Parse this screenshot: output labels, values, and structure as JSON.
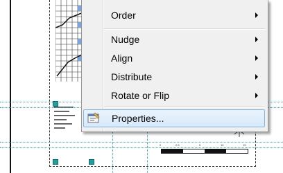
{
  "context_menu": {
    "items": [
      {
        "label": "Order",
        "has_submenu": true
      },
      {
        "label": "Nudge",
        "has_submenu": true
      },
      {
        "label": "Align",
        "has_submenu": true
      },
      {
        "label": "Distribute",
        "has_submenu": true
      },
      {
        "label": "Rotate or Flip",
        "has_submenu": true
      },
      {
        "label": "Properties...",
        "has_submenu": false,
        "highlighted": true,
        "icon": "properties-icon"
      }
    ]
  },
  "layout_view": {
    "scalebar_ticks": [
      "0",
      "2.5",
      "5",
      "10",
      "15"
    ],
    "guide_color": "#2aa7d6",
    "highlight_color": "#d8e9fa",
    "selection_handle_color": "#1fa0a0"
  }
}
